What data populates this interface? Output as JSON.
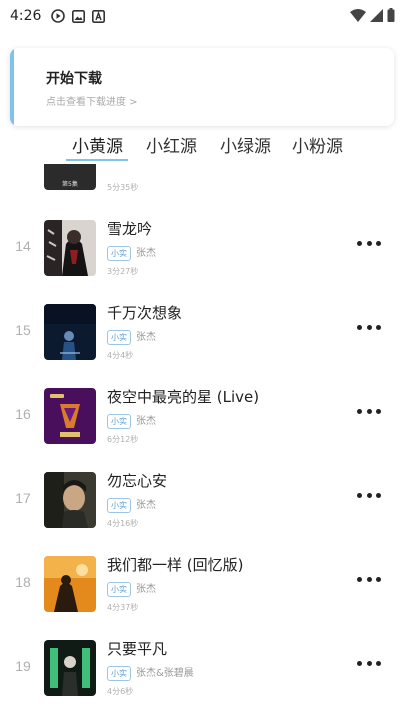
{
  "status_bar": {
    "time": "4:26",
    "left_icons": [
      "play-circle-icon",
      "image-icon",
      "a-letter-icon"
    ],
    "right_icons": [
      "wifi-icon",
      "cellular-signal-icon",
      "battery-icon"
    ]
  },
  "download_card": {
    "title": "开始下载",
    "subtitle": "点击查看下载进度 >"
  },
  "tabs": [
    {
      "label": "小黄源",
      "active": true
    },
    {
      "label": "小红源",
      "active": false
    },
    {
      "label": "小绿源",
      "active": false
    },
    {
      "label": "小粉源",
      "active": false
    }
  ],
  "partial_song": {
    "duration": "5分35秒",
    "cover_text": "第5集"
  },
  "songs": [
    {
      "index": "14",
      "title": "雪龙吟",
      "quality": "小实",
      "artist": "张杰",
      "duration": "3分27秒"
    },
    {
      "index": "15",
      "title": "千万次想象",
      "quality": "小实",
      "artist": "张杰",
      "duration": "4分4秒"
    },
    {
      "index": "16",
      "title": "夜空中最亮的星 (Live)",
      "quality": "小实",
      "artist": "张杰",
      "duration": "6分12秒"
    },
    {
      "index": "17",
      "title": "勿忘心安",
      "quality": "小实",
      "artist": "张杰",
      "duration": "4分16秒"
    },
    {
      "index": "18",
      "title": "我们都一样 (回忆版)",
      "quality": "小实",
      "artist": "张杰",
      "duration": "4分37秒"
    },
    {
      "index": "19",
      "title": "只要平凡",
      "quality": "小实",
      "artist": "张杰&张碧晨",
      "duration": "4分6秒"
    }
  ],
  "colors": {
    "accent": "#7fc2ea",
    "badge_border": "#9cc6e4",
    "badge_text": "#5b9dcc",
    "secondary_text": "#999999"
  }
}
